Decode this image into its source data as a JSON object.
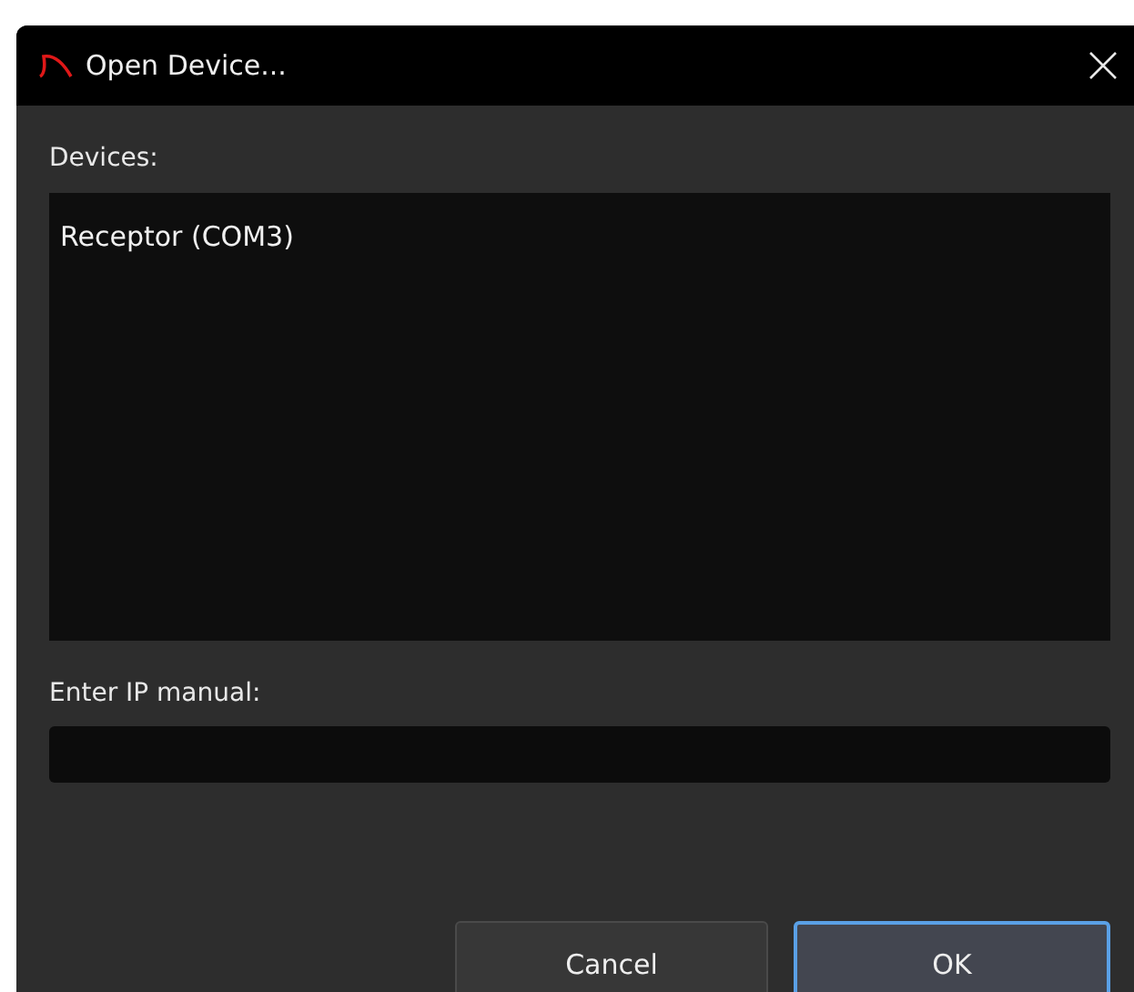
{
  "window": {
    "title": "Open Device..."
  },
  "devices": {
    "label": "Devices:",
    "items": [
      {
        "label": "Receptor (COM3)",
        "selected": false
      }
    ]
  },
  "ip_field": {
    "label": "Enter IP manual:"
  },
  "buttons": [
    {
      "label": "Cancel",
      "default": false
    },
    {
      "label": "OK",
      "default": true
    }
  ]
}
